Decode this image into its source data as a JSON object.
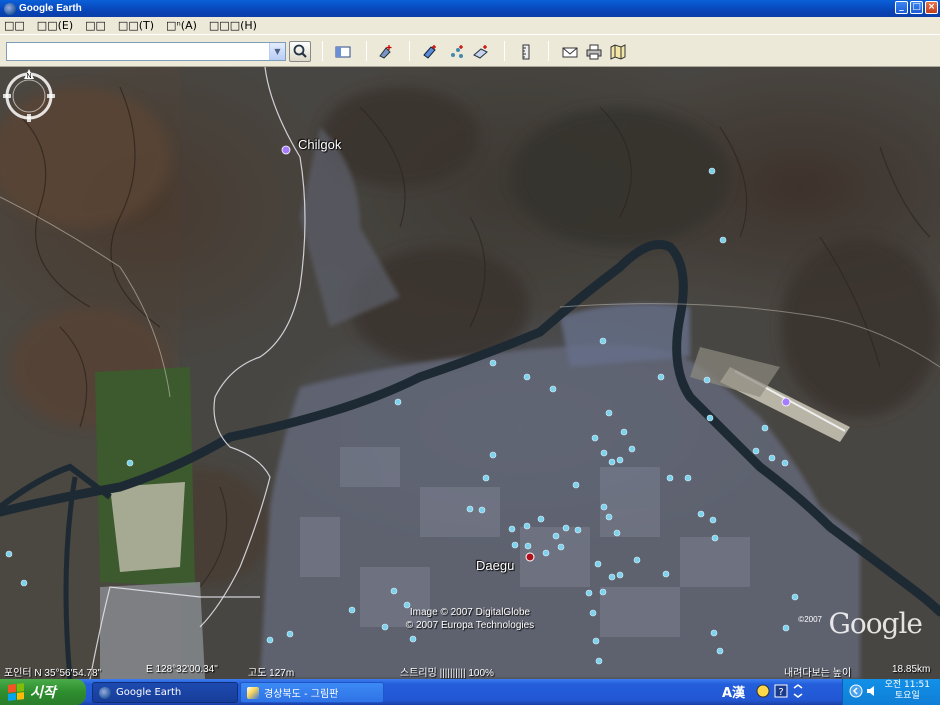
{
  "window": {
    "title": "Google Earth"
  },
  "menu": {
    "items": [
      "□□",
      "□□(E)",
      "□□",
      "□□(T)",
      "□ⁿ(A)",
      "□□□(H)"
    ]
  },
  "toolbar": {
    "search_value": "",
    "icons": [
      "sidebar-toggle-icon",
      "placemark-add-icon",
      "polygon-icon",
      "path-icon",
      "image-overlay-icon",
      "ruler-icon",
      "email-icon",
      "print-icon",
      "google-maps-icon"
    ]
  },
  "map": {
    "places": [
      {
        "name": "Chilgok"
      },
      {
        "name": "Daegu"
      }
    ],
    "copyright": [
      "Image © 2007 DigitalGlobe",
      "© 2007 Europa Technologies"
    ],
    "logo": "Google",
    "logo_year": "©2007",
    "compass_north": "N"
  },
  "status": {
    "pointer": "포인터 N 35°56'54.78\"",
    "longitude": "E 128°32'00.34\"",
    "elevation": "고도 127m",
    "streaming": "스트리밍 |||||||||| 100%",
    "eye_alt": "내려다보는 높이",
    "eye_alt_value": "18.85km"
  },
  "taskbar": {
    "start_label": "시작",
    "tasks": [
      {
        "label": "Google Earth",
        "active": true
      },
      {
        "label": "경상북도 - 그림판",
        "active": false
      }
    ],
    "ime": "A漢",
    "clock_time": "오전 11:51",
    "clock_day": "토요일"
  },
  "colors": {
    "river": "#1e2a33",
    "road": "#e8e8f0",
    "city": "#6c7488",
    "poi": "#7fd8f4",
    "place_marker": "#a67cff",
    "daegu_marker": "#b0101a"
  }
}
